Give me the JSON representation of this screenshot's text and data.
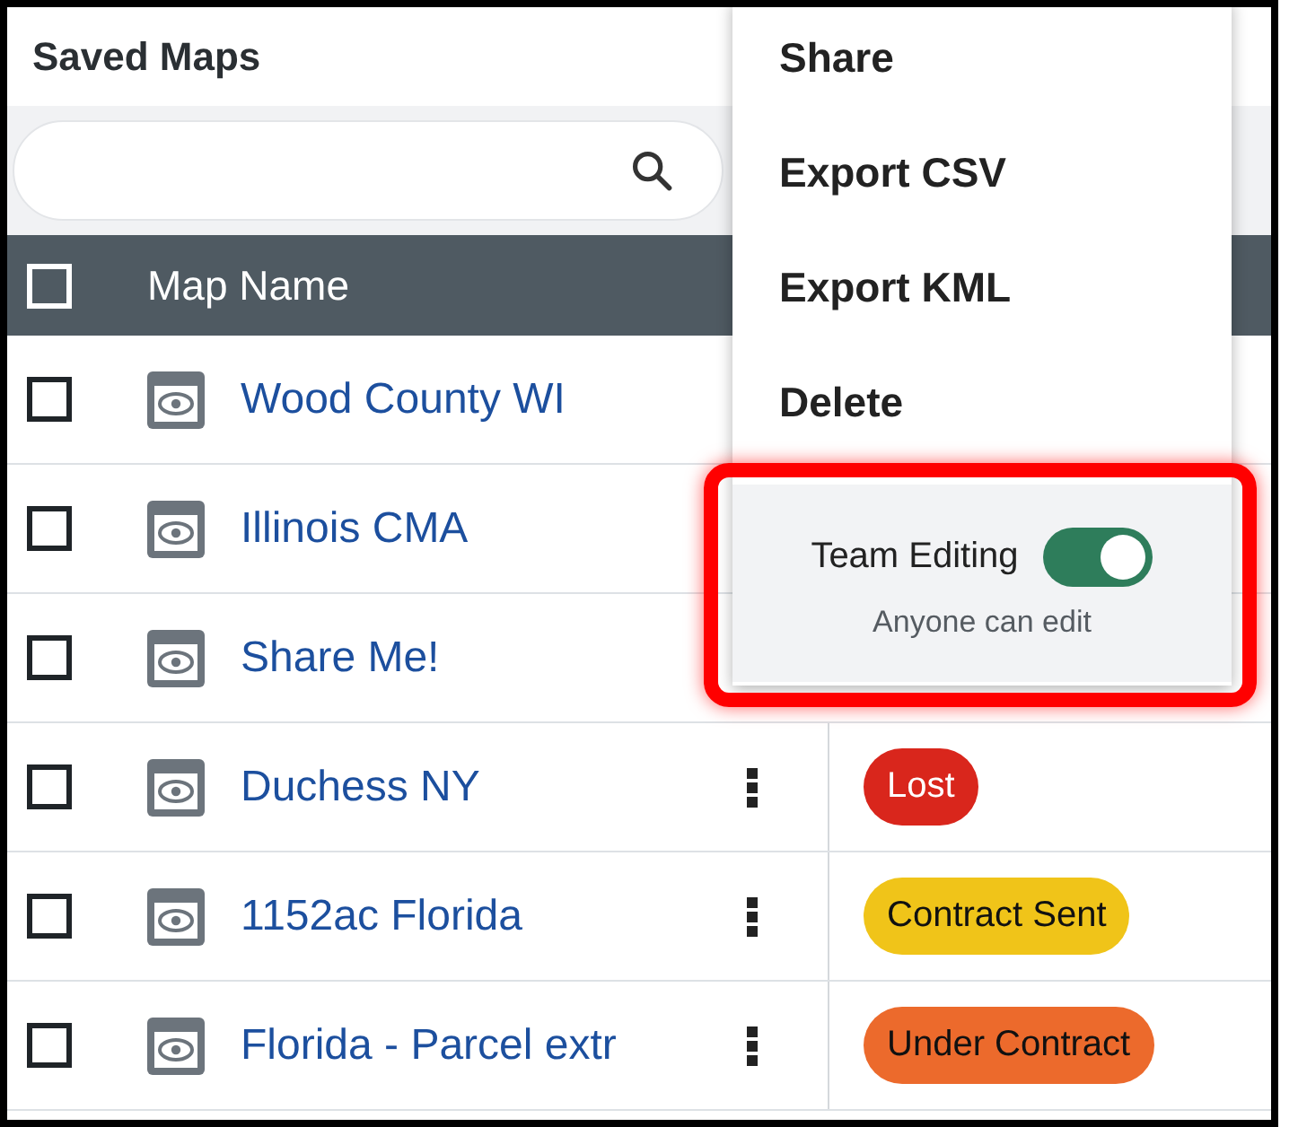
{
  "title": "Saved Maps",
  "table": {
    "header_checked": false,
    "columns": [
      "Map Name"
    ],
    "rows": [
      {
        "name": "Wood County WI",
        "checked": false
      },
      {
        "name": "Illinois CMA",
        "checked": false
      },
      {
        "name": "Share Me!",
        "checked": false
      },
      {
        "name": "Duchess NY",
        "checked": false,
        "status": "Lost",
        "color": "#d9261c"
      },
      {
        "name": "1152ac Florida",
        "checked": false,
        "status": "Contract Sent",
        "color": "#f0c419"
      },
      {
        "name": "Florida - Parcel extr",
        "checked": false,
        "status": "Under Contract",
        "color": "#ec6a2c"
      }
    ]
  },
  "menu": {
    "items": [
      "Share",
      "Export CSV",
      "Export KML",
      "Delete"
    ],
    "team_editing": {
      "label": "Team Editing",
      "on": true,
      "caption": "Anyone can edit"
    }
  }
}
